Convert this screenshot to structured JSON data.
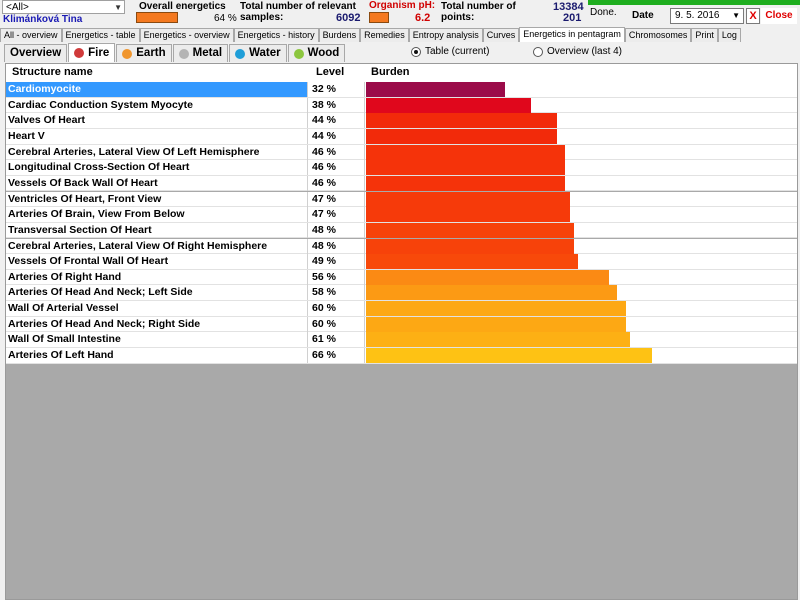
{
  "toolbar": {
    "filter_value": "<All>",
    "patient_name": "Klimánková Tina",
    "overall_label": "Overall energetics",
    "overall_percent": "64 %",
    "overall_fraction": 0.64,
    "samples_label_line1": "Total number of relevant",
    "samples_label_line2": "samples:",
    "samples_value": "6092",
    "ph_label": "Organism pH:",
    "ph_value": "6.2",
    "points_label_line1": "Total number of",
    "points_label_line2": "points:",
    "points_value_top": "13384",
    "points_value": "201",
    "status": "Done.",
    "date_label": "Date",
    "date_value": "9. 5. 2016",
    "x_label": "X",
    "close_label": "Close"
  },
  "tabs": [
    {
      "label": "All - overview"
    },
    {
      "label": "Energetics - table"
    },
    {
      "label": "Energetics - overview"
    },
    {
      "label": "Energetics - history"
    },
    {
      "label": "Burdens"
    },
    {
      "label": "Remedies"
    },
    {
      "label": "Entropy analysis"
    },
    {
      "label": "Curves"
    },
    {
      "label": "Energetics in pentagram"
    },
    {
      "label": "Chromosomes"
    },
    {
      "label": "Print"
    },
    {
      "label": "Log"
    }
  ],
  "element_tabs": [
    {
      "label": "Overview",
      "color": null
    },
    {
      "label": "Fire",
      "color": "#d03a3a"
    },
    {
      "label": "Earth",
      "color": "#f0962e"
    },
    {
      "label": "Metal",
      "color": "#b4b4b4"
    },
    {
      "label": "Water",
      "color": "#1f9ed8"
    },
    {
      "label": "Wood",
      "color": "#8cc63e"
    }
  ],
  "view_options": {
    "table_label": "Table (current)",
    "overview_label": "Overview (last 4)"
  },
  "table": {
    "columns": [
      "Structure name",
      "Level",
      "Burden"
    ],
    "rows": [
      {
        "name": "Cardiomyocite",
        "level": "32 %",
        "burden": 0.32,
        "color": "#9b0b49"
      },
      {
        "name": "Cardiac Conduction System Myocyte",
        "level": "38 %",
        "burden": 0.38,
        "color": "#e0071c"
      },
      {
        "name": "Valves Of Heart",
        "level": "44 %",
        "burden": 0.44,
        "color": "#f22a0a"
      },
      {
        "name": "Heart V",
        "level": "44 %",
        "burden": 0.44,
        "color": "#f22a0a"
      },
      {
        "name": "Cerebral Arteries, Lateral View Of Left Hemisphere",
        "level": "46 %",
        "burden": 0.46,
        "color": "#f5330a"
      },
      {
        "name": "Longitudinal Cross-Section Of Heart",
        "level": "46 %",
        "burden": 0.46,
        "color": "#f5330a"
      },
      {
        "name": "Vessels Of Back Wall Of Heart",
        "level": "46 %",
        "burden": 0.46,
        "color": "#f5330a"
      },
      {
        "name": "Ventricles Of Heart, Front View",
        "level": "47 %",
        "burden": 0.47,
        "color": "#f63a0a"
      },
      {
        "name": "Arteries Of Brain, View From Below",
        "level": "47 %",
        "burden": 0.47,
        "color": "#f63a0a"
      },
      {
        "name": "Transversal Section Of Heart",
        "level": "48 %",
        "burden": 0.48,
        "color": "#f7420a"
      },
      {
        "name": "Cerebral Arteries, Lateral View Of Right Hemisphere",
        "level": "48 %",
        "burden": 0.48,
        "color": "#f7420a"
      },
      {
        "name": "Vessels Of Frontal Wall Of Heart",
        "level": "49 %",
        "burden": 0.49,
        "color": "#f8490a"
      },
      {
        "name": "Arteries Of Right Hand",
        "level": "56 %",
        "burden": 0.56,
        "color": "#fb8a14"
      },
      {
        "name": "Arteries Of Head And Neck; Left Side",
        "level": "58 %",
        "burden": 0.58,
        "color": "#fc9a14"
      },
      {
        "name": "Wall Of Arterial Vessel",
        "level": "60 %",
        "burden": 0.6,
        "color": "#fda814"
      },
      {
        "name": "Arteries Of Head And Neck; Right Side",
        "level": "60 %",
        "burden": 0.6,
        "color": "#fda814"
      },
      {
        "name": "Wall Of Small Intestine",
        "level": "61 %",
        "burden": 0.61,
        "color": "#fdb014"
      },
      {
        "name": "Arteries Of Left Hand",
        "level": "66 %",
        "burden": 0.66,
        "color": "#fec214"
      }
    ],
    "selected_index": 0
  }
}
